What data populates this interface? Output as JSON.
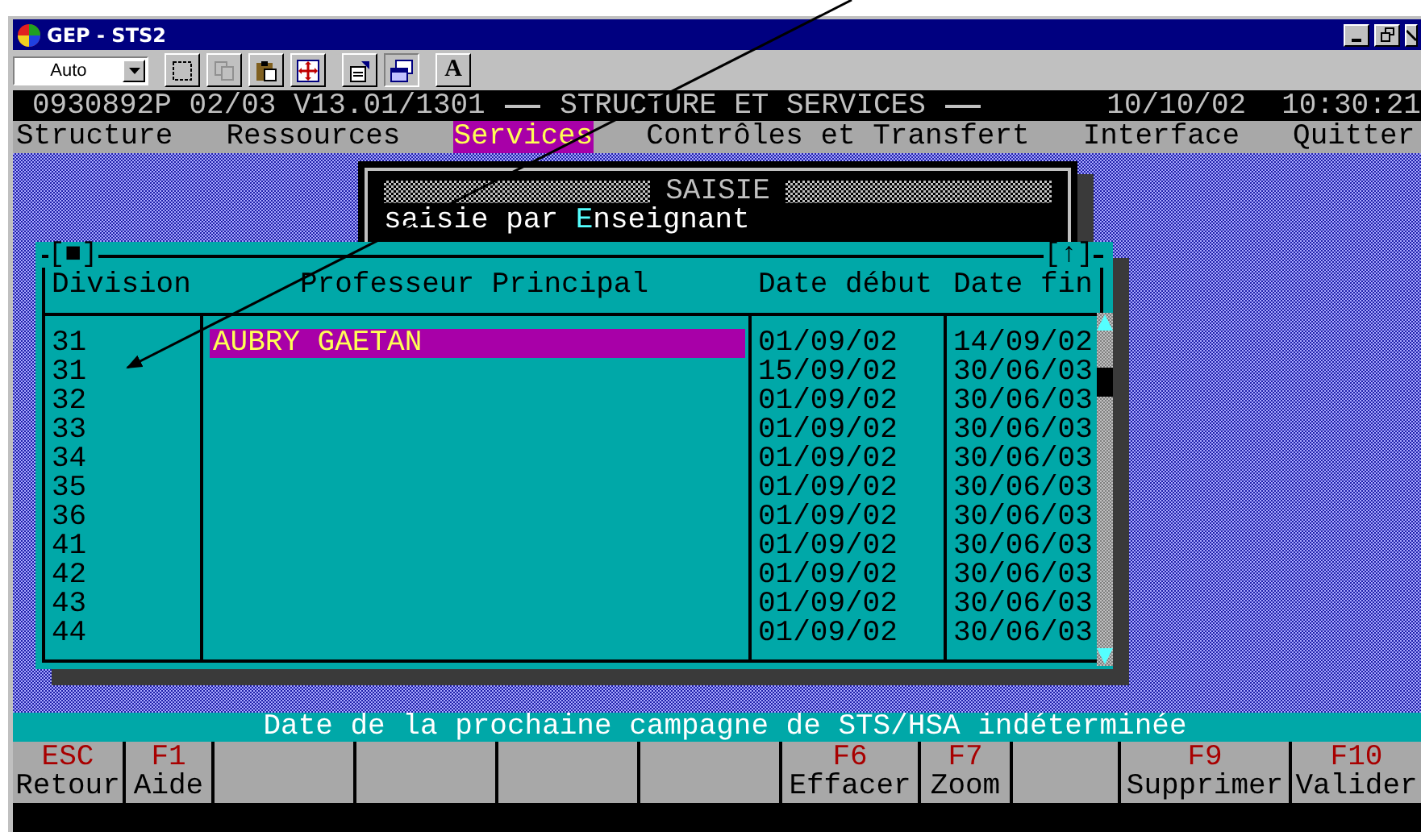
{
  "window": {
    "title": "GEP - STS2"
  },
  "toolbar": {
    "font_combo": "Auto",
    "font_button": "A"
  },
  "header": {
    "code": "0930892P 02/03 V13.01/1301",
    "title": "STRUCTURE ET SERVICES",
    "date": "10/10/02",
    "time": "10:30:21"
  },
  "menu": [
    {
      "label": "Structure",
      "selected": false
    },
    {
      "label": "Ressources",
      "selected": false
    },
    {
      "label": "Services",
      "selected": true
    },
    {
      "label": "Contrôles et Transfert",
      "selected": false
    },
    {
      "label": "Interface",
      "selected": false
    },
    {
      "label": "Quitter",
      "selected": false
    }
  ],
  "saisie_box": {
    "title": "SAISIE",
    "option_before": "saisie par ",
    "option_hotkey": "E",
    "option_after": "nseignant"
  },
  "dialog": {
    "close_mark": "[■]",
    "arrow_mark": "[↑]",
    "columns": [
      "Division",
      "Professeur Principal",
      "Date début",
      "Date fin"
    ],
    "rows": [
      {
        "division": "31",
        "professeur": "AUBRY GAETAN",
        "debut": "01/09/02",
        "fin": "14/09/02",
        "selected": true
      },
      {
        "division": "31",
        "debut": "15/09/02",
        "fin": "30/06/03",
        "selected": false
      },
      {
        "division": "32",
        "debut": "01/09/02",
        "fin": "30/06/03",
        "selected": false
      },
      {
        "division": "33",
        "debut": "01/09/02",
        "fin": "30/06/03",
        "selected": false
      },
      {
        "division": "34",
        "debut": "01/09/02",
        "fin": "30/06/03",
        "selected": false
      },
      {
        "division": "35",
        "debut": "01/09/02",
        "fin": "30/06/03",
        "selected": false
      },
      {
        "division": "36",
        "debut": "01/09/02",
        "fin": "30/06/03",
        "selected": false
      },
      {
        "division": "41",
        "debut": "01/09/02",
        "fin": "30/06/03",
        "selected": false
      },
      {
        "division": "42",
        "debut": "01/09/02",
        "fin": "30/06/03",
        "selected": false
      },
      {
        "division": "43",
        "debut": "01/09/02",
        "fin": "30/06/03",
        "selected": false
      },
      {
        "division": "44",
        "debut": "01/09/02",
        "fin": "30/06/03",
        "selected": false
      }
    ]
  },
  "status_line": "Date de la prochaine campagne de STS/HSA indéterminée",
  "function_keys": [
    {
      "kind": "key",
      "key": "ESC",
      "action": "Retour"
    },
    {
      "kind": "key",
      "key": "F1",
      "action": "Aide"
    },
    {
      "kind": "blank"
    },
    {
      "kind": "blank"
    },
    {
      "kind": "blank"
    },
    {
      "kind": "blank"
    },
    {
      "kind": "key",
      "key": "F6",
      "action": "Effacer"
    },
    {
      "kind": "key",
      "key": "F7",
      "action": "Zoom"
    },
    {
      "kind": "blank"
    },
    {
      "kind": "key",
      "key": "F9",
      "action": "Supprimer"
    },
    {
      "kind": "key",
      "key": "F10",
      "action": "Valider"
    }
  ]
}
